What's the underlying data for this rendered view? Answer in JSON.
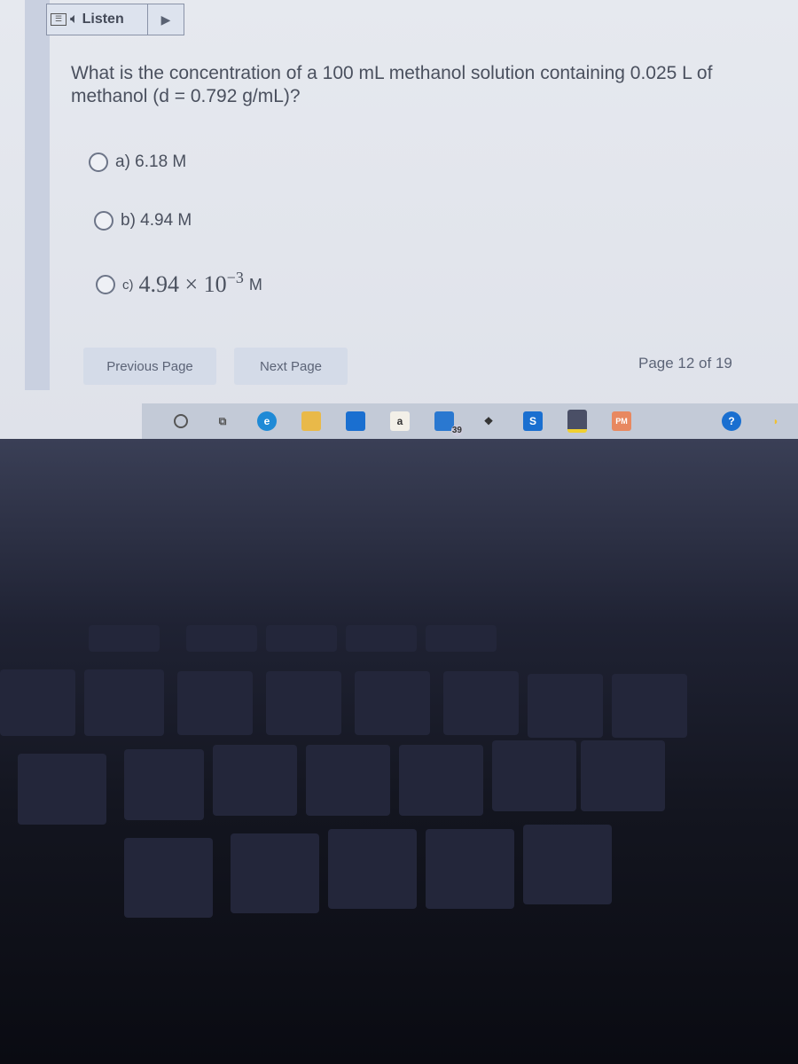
{
  "toolbar": {
    "listen_label": "Listen",
    "menu_icon": "menu-icon",
    "speaker_icon": "speaker-icon",
    "play_icon": "play-icon"
  },
  "question": {
    "text": "What is the concentration of a 100 mL methanol solution containing 0.025 L of methanol (d = 0.792 g/mL)?"
  },
  "options": [
    {
      "label": "a) 6.18 M"
    },
    {
      "label": "b) 4.94 M"
    },
    {
      "prefix": "c)",
      "mantissa": "4.94 × 10",
      "exponent": "−3",
      "unit": "M"
    }
  ],
  "nav": {
    "previous_label": "Previous Page",
    "next_label": "Next Page",
    "page_indicator": "Page 12 of 19"
  },
  "taskbar": {
    "mail_badge": "39",
    "amazon_label": "a",
    "pm_label": "PM"
  }
}
